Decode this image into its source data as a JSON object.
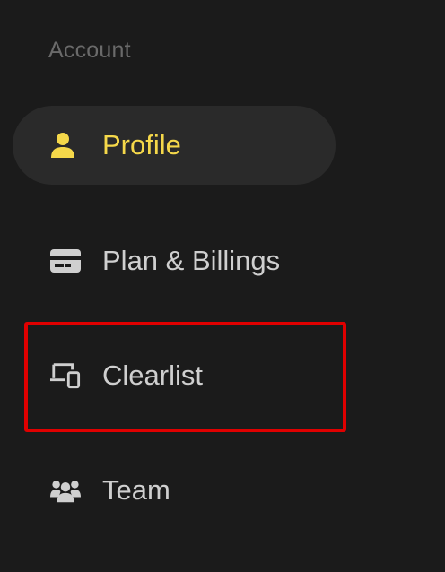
{
  "sidebar": {
    "section_label": "Account",
    "accent_color": "#f5d84a",
    "highlight_color": "#e00000",
    "items": [
      {
        "label": "Profile",
        "icon": "user-icon",
        "active": true
      },
      {
        "label": "Plan & Billings",
        "icon": "credit-card-icon",
        "active": false
      },
      {
        "label": "Clearlist",
        "icon": "devices-icon",
        "active": false,
        "highlighted": true
      },
      {
        "label": "Team",
        "icon": "users-icon",
        "active": false
      }
    ]
  }
}
